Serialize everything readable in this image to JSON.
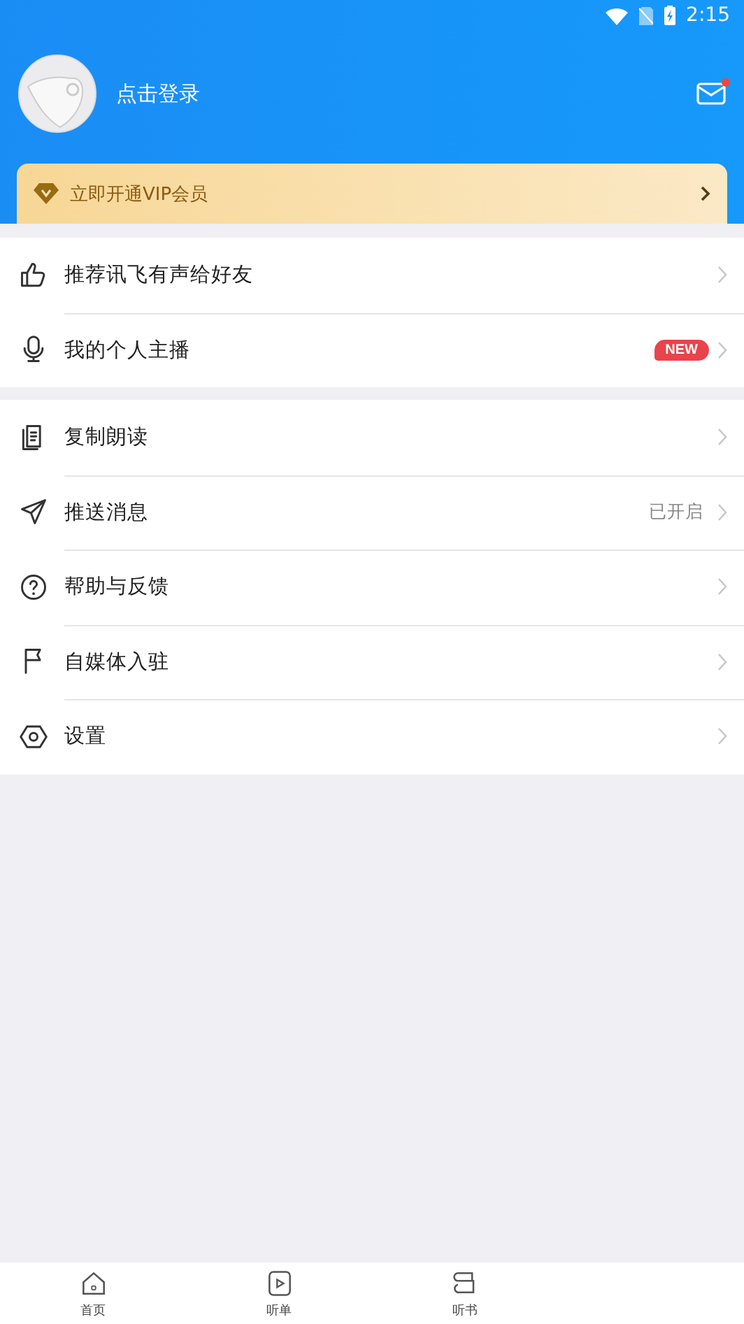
{
  "status_bar": {
    "time": "2:15"
  },
  "profile": {
    "login_prompt": "点击登录",
    "unread_messages": true
  },
  "vip_banner": {
    "label": "立即开通VIP会员"
  },
  "menu_groups": [
    {
      "items": [
        {
          "label": "推荐讯飞有声给好友"
        },
        {
          "label": "我的个人主播",
          "badge": "NEW"
        }
      ]
    },
    {
      "items": [
        {
          "label": "复制朗读"
        },
        {
          "label": "推送消息",
          "status": "已开启"
        },
        {
          "label": "帮助与反馈"
        },
        {
          "label": "自媒体入驻"
        },
        {
          "label": "设置"
        }
      ]
    }
  ],
  "bottom_nav": [
    {
      "label": "首页"
    },
    {
      "label": "听单"
    },
    {
      "label": "听书"
    }
  ]
}
